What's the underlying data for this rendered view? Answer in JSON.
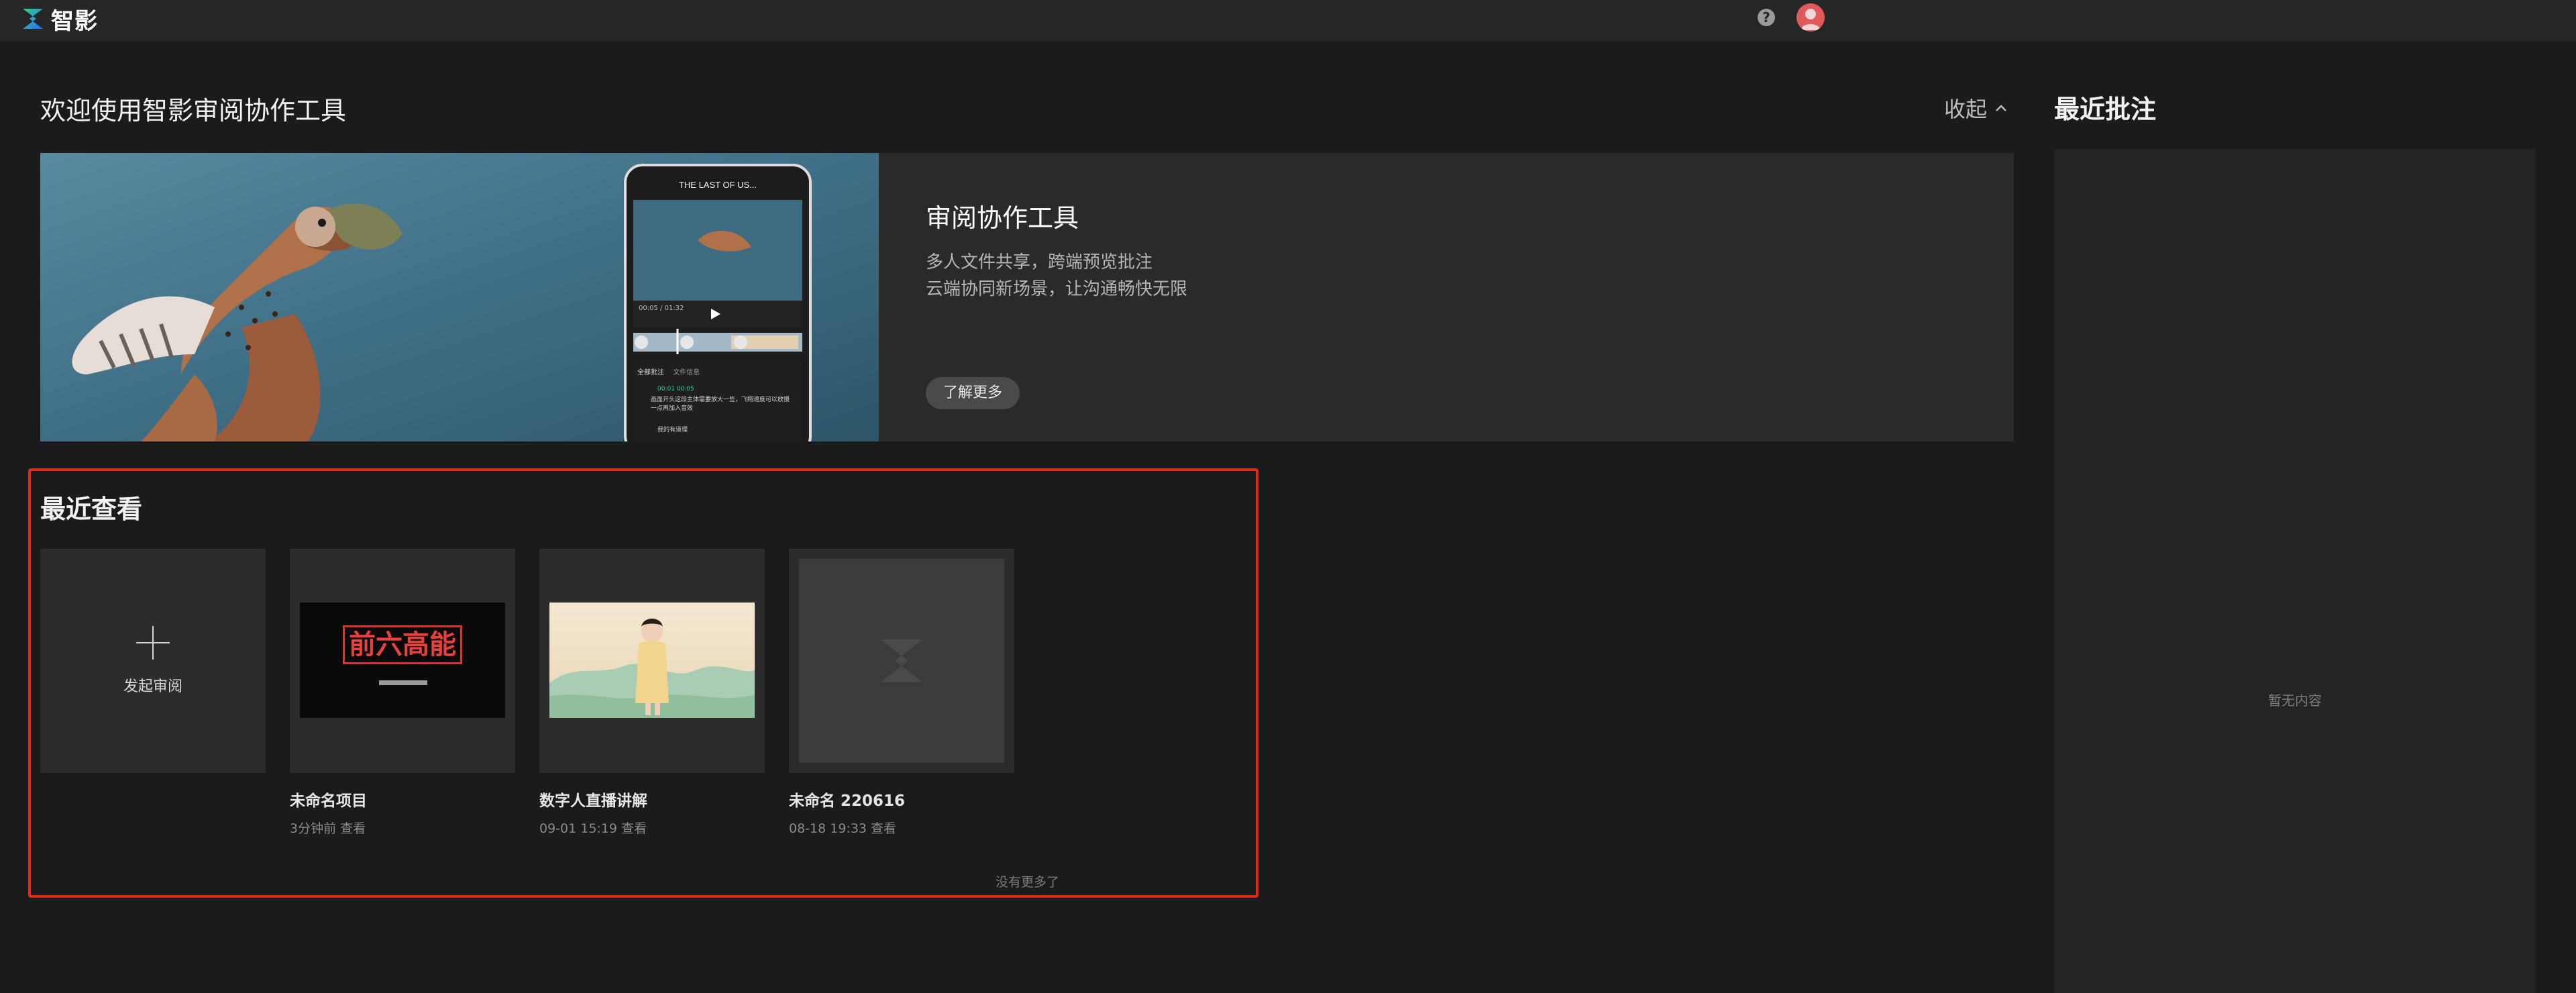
{
  "app": {
    "name": "智影"
  },
  "header": {
    "help_icon": "question-circle-icon",
    "avatar_icon": "user-avatar-icon"
  },
  "welcome": {
    "title": "欢迎使用智影审阅协作工具",
    "collapse_label": "收起",
    "banner": {
      "heading": "审阅协作工具",
      "line1": "多人文件共享，跨端预览批注",
      "line2": "云端协同新场景，让沟通畅快无限",
      "button": "了解更多",
      "phone_title": "THE LAST OF US...",
      "phone_time": "00:05",
      "phone_time_total": "/ 01:32",
      "phone_tab_comments": "全部批注",
      "phone_tab_files": "文件信息",
      "phone_comment_time": "00:01 00:05",
      "phone_comment_text": "画面开头这段主体需要放大一些，飞翔速度可以放慢一点再加入音效",
      "phone_reply": "我的有道理"
    }
  },
  "recent_viewed": {
    "title": "最近查看",
    "new_review_label": "发起审阅",
    "items": [
      {
        "name": "未命名项目",
        "time": "3分钟前 查看",
        "thumb_text": "前六高能"
      },
      {
        "name": "数字人直播讲解",
        "time": "09-01 15:19 查看"
      },
      {
        "name": "未命名  220616",
        "time": "08-18 19:33 查看"
      }
    ],
    "no_more": "没有更多了"
  },
  "recent_comments": {
    "title": "最近批注",
    "empty": "暂无内容"
  },
  "colors": {
    "accent": "#e02a1e",
    "logo_green": "#2fd38a",
    "logo_blue": "#2a6bff"
  }
}
